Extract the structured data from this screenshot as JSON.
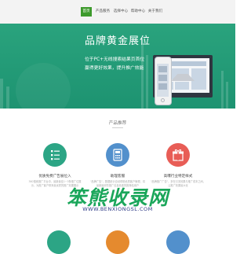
{
  "nav": {
    "items": [
      {
        "label": "首页",
        "active": true
      },
      {
        "label": "产品服务",
        "active": false
      },
      {
        "label": "选择中心",
        "active": false
      },
      {
        "label": "帮助中心",
        "active": false
      },
      {
        "label": "关于我们",
        "active": false
      }
    ]
  },
  "hero": {
    "title": "品牌黄金展位",
    "line1": "位于PC+无线搜索结果页首位",
    "line2": "赢得更好效果，提升推广效能",
    "colors": {
      "from": "#2aa37d",
      "to": "#1d9371"
    },
    "devices": [
      "monitor-illustration",
      "phone-illustration"
    ]
  },
  "products": {
    "title": "产品推荐",
    "cards": [
      {
        "title": "优质免费广告展位入",
        "desc": "360搜索推广平台中，最新最佳1~3条推广位展示，为推广客户带来最优质的推广效果展示",
        "color": "#2ca585",
        "icon": "list-icon"
      },
      {
        "title": "助理客服",
        "desc": "\"品牌广告\"，数据统计自动帮助优质客户管理，将最新最好的推广信息精准的推荐给用户",
        "color": "#5290cc",
        "icon": "calculator-icon"
      },
      {
        "title": "高曝行业特定样式",
        "desc": "\"品牌推广广告\"，多在引流效果与推广成本之间，让推广效果最大化",
        "color": "#e85d56",
        "icon": "gift-icon"
      }
    ]
  },
  "watermark": {
    "text": "笨熊收录网",
    "url": "WWW.BENXIONGSL.COM"
  },
  "peek_icons": [
    {
      "color": "#2ca585",
      "icon": "next-green-icon"
    },
    {
      "color": "#e58a2e",
      "icon": "next-orange-icon"
    },
    {
      "color": "#5290cc",
      "icon": "next-blue-icon"
    }
  ]
}
